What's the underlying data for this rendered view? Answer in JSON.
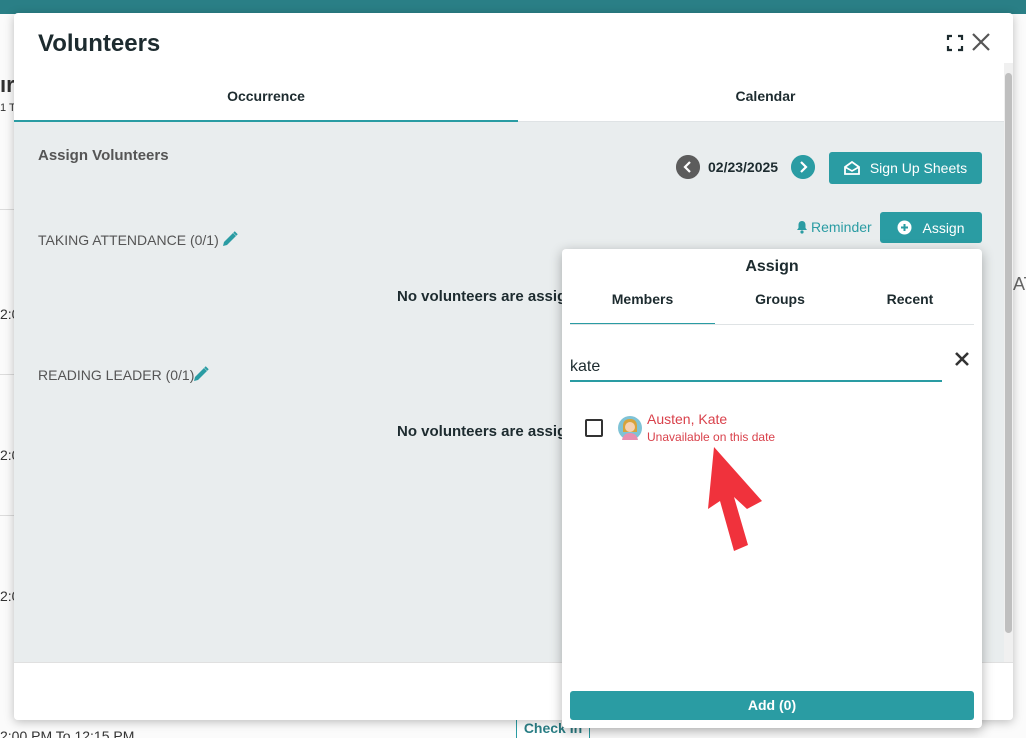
{
  "modal": {
    "title": "Volunteers",
    "tabs": [
      {
        "label": "Occurrence"
      },
      {
        "label": "Calendar"
      }
    ],
    "section_title": "Assign Volunteers",
    "date": "02/23/2025",
    "signup_label": "Sign Up Sheets",
    "reminder_label": "Reminder",
    "assign_label": "Assign",
    "roles": [
      {
        "title": "TAKING ATTENDANCE (0/1)",
        "empty_text": "No volunteers are assig"
      },
      {
        "title": "READING LEADER (0/1)",
        "empty_text": "No volunteers are assig"
      }
    ]
  },
  "assign_popup": {
    "title": "Assign",
    "tabs": [
      {
        "label": "Members"
      },
      {
        "label": "Groups"
      },
      {
        "label": "Recent"
      }
    ],
    "search_value": "kate",
    "results": [
      {
        "name": "Austen, Kate",
        "status": "Unavailable on this date"
      }
    ],
    "add_label": "Add (0)"
  },
  "background": {
    "fragments": [
      "ır",
      "1 T",
      "2:0",
      "2:0",
      "2:0",
      "2:00 PM To 12:15 PM"
    ],
    "check_in_label": "Check In",
    "right_fragment": "AT"
  },
  "colors": {
    "accent": "#2a9ca3",
    "unavailable": "#d9414b",
    "annotation_arrow": "#f0323c"
  }
}
